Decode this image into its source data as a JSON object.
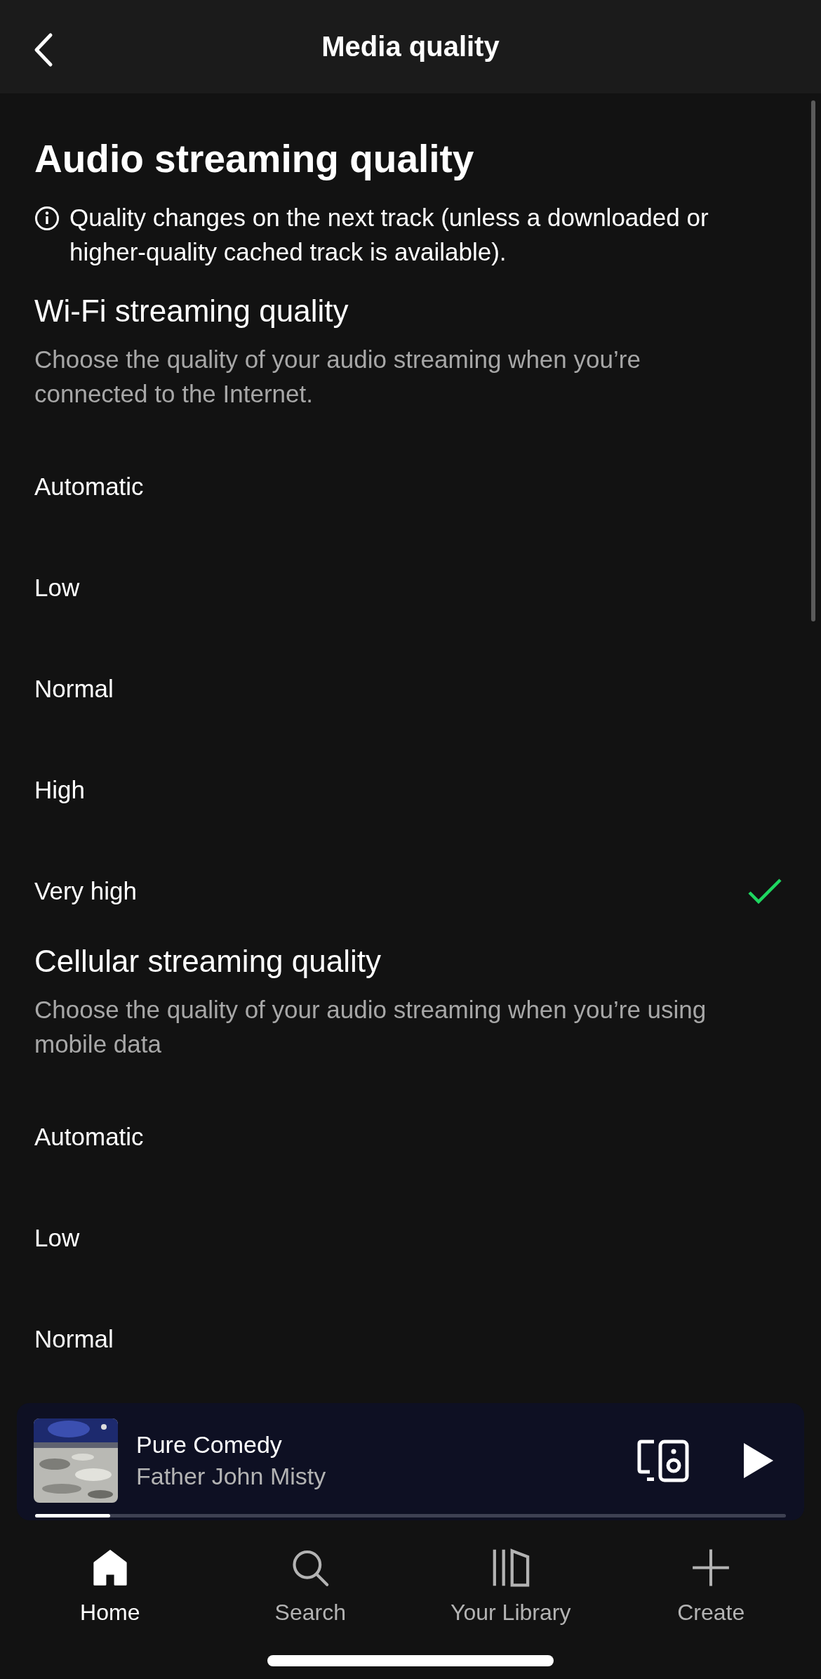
{
  "header": {
    "title": "Media quality"
  },
  "section": {
    "title": "Audio streaming quality",
    "info": "Quality changes on the next track (unless a downloaded or higher-quality cached track is available)."
  },
  "groups": [
    {
      "title": "Wi-Fi streaming quality",
      "description": "Choose the quality of your audio streaming when you’re connected to the Internet.",
      "options": [
        {
          "label": "Automatic",
          "selected": false
        },
        {
          "label": "Low",
          "selected": false
        },
        {
          "label": "Normal",
          "selected": false
        },
        {
          "label": "High",
          "selected": false
        },
        {
          "label": "Very high",
          "selected": true
        }
      ]
    },
    {
      "title": "Cellular streaming quality",
      "description": "Choose the quality of your audio streaming when you’re using mobile data",
      "options": [
        {
          "label": "Automatic",
          "selected": false
        },
        {
          "label": "Low",
          "selected": false
        },
        {
          "label": "Normal",
          "selected": false
        }
      ]
    }
  ],
  "player": {
    "title": "Pure Comedy",
    "artist": "Father John Misty",
    "level": 0.1
  },
  "nav": [
    {
      "label": "Home",
      "selected": true
    },
    {
      "label": "Search",
      "selected": false
    },
    {
      "label": "Your Library",
      "selected": false
    },
    {
      "label": "Create",
      "selected": false
    }
  ]
}
